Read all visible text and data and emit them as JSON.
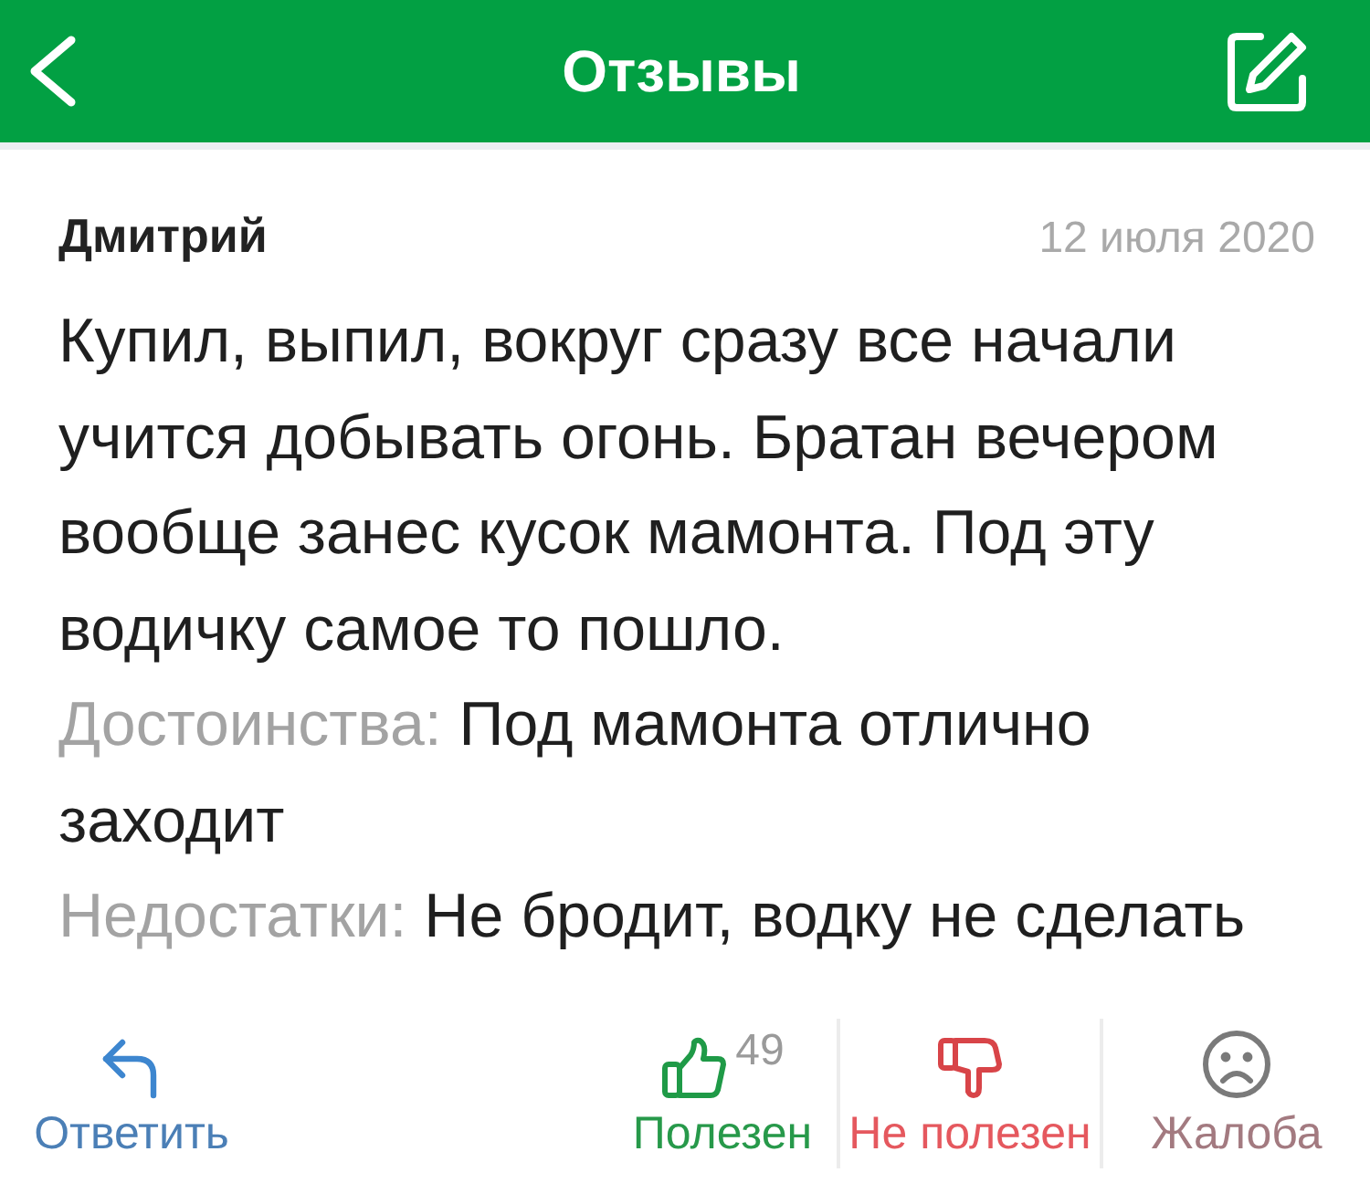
{
  "header": {
    "title": "Отзывы"
  },
  "review": {
    "author": "Дмитрий",
    "date": "12 июля 2020",
    "text": "Купил, выпил, вокруг сразу все начали учится добывать огонь. Братан вечером вообще занес кусок мамонта. Под эту водичку самое то пошло.",
    "pros": {
      "label": "Достоинства:",
      "value": "Под мамонта отлично заходит"
    },
    "cons": {
      "label": "Недостатки:",
      "value": "Не бродит, водку не сделать"
    }
  },
  "actions": [
    {
      "kind": "reply",
      "label": "Ответить"
    },
    {
      "kind": "helpful",
      "label": "Полезен",
      "count": "49"
    },
    {
      "kind": "not_helpful",
      "label": "Не полезен"
    },
    {
      "kind": "complaint",
      "label": "Жалоба"
    }
  ]
}
